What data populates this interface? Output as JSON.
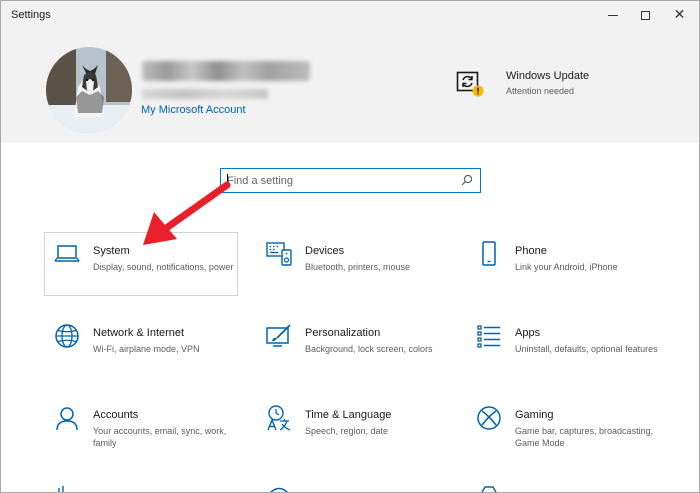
{
  "window": {
    "title": "Settings",
    "minimize_glyph": "—",
    "close_glyph": "✕"
  },
  "header": {
    "account_link": "My Microsoft Account",
    "update": {
      "title": "Windows Update",
      "status": "Attention needed",
      "icon": "windows-update-icon"
    }
  },
  "search": {
    "placeholder": "Find a setting"
  },
  "tiles": [
    {
      "name": "System",
      "desc": "Display, sound, notifications, power",
      "icon": "laptop-icon"
    },
    {
      "name": "Devices",
      "desc": "Bluetooth, printers, mouse",
      "icon": "devices-icon"
    },
    {
      "name": "Phone",
      "desc": "Link your Android, iPhone",
      "icon": "phone-icon"
    },
    {
      "name": "Network & Internet",
      "desc": "Wi-Fi, airplane mode, VPN",
      "icon": "globe-icon"
    },
    {
      "name": "Personalization",
      "desc": "Background, lock screen, colors",
      "icon": "personalization-icon"
    },
    {
      "name": "Apps",
      "desc": "Uninstall, defaults, optional features",
      "icon": "apps-list-icon"
    },
    {
      "name": "Accounts",
      "desc": "Your accounts, email, sync, work, family",
      "icon": "person-icon"
    },
    {
      "name": "Time & Language",
      "desc": "Speech, region, date",
      "icon": "time-language-icon"
    },
    {
      "name": "Gaming",
      "desc": "Game bar, captures, broadcasting, Game Mode",
      "icon": "xbox-icon"
    }
  ],
  "colors": {
    "accent": "#0078d7",
    "link": "#0063b1",
    "header_bg": "#f2f2f2",
    "annotation_arrow": "#e8202a",
    "warning": "#f7b900"
  }
}
